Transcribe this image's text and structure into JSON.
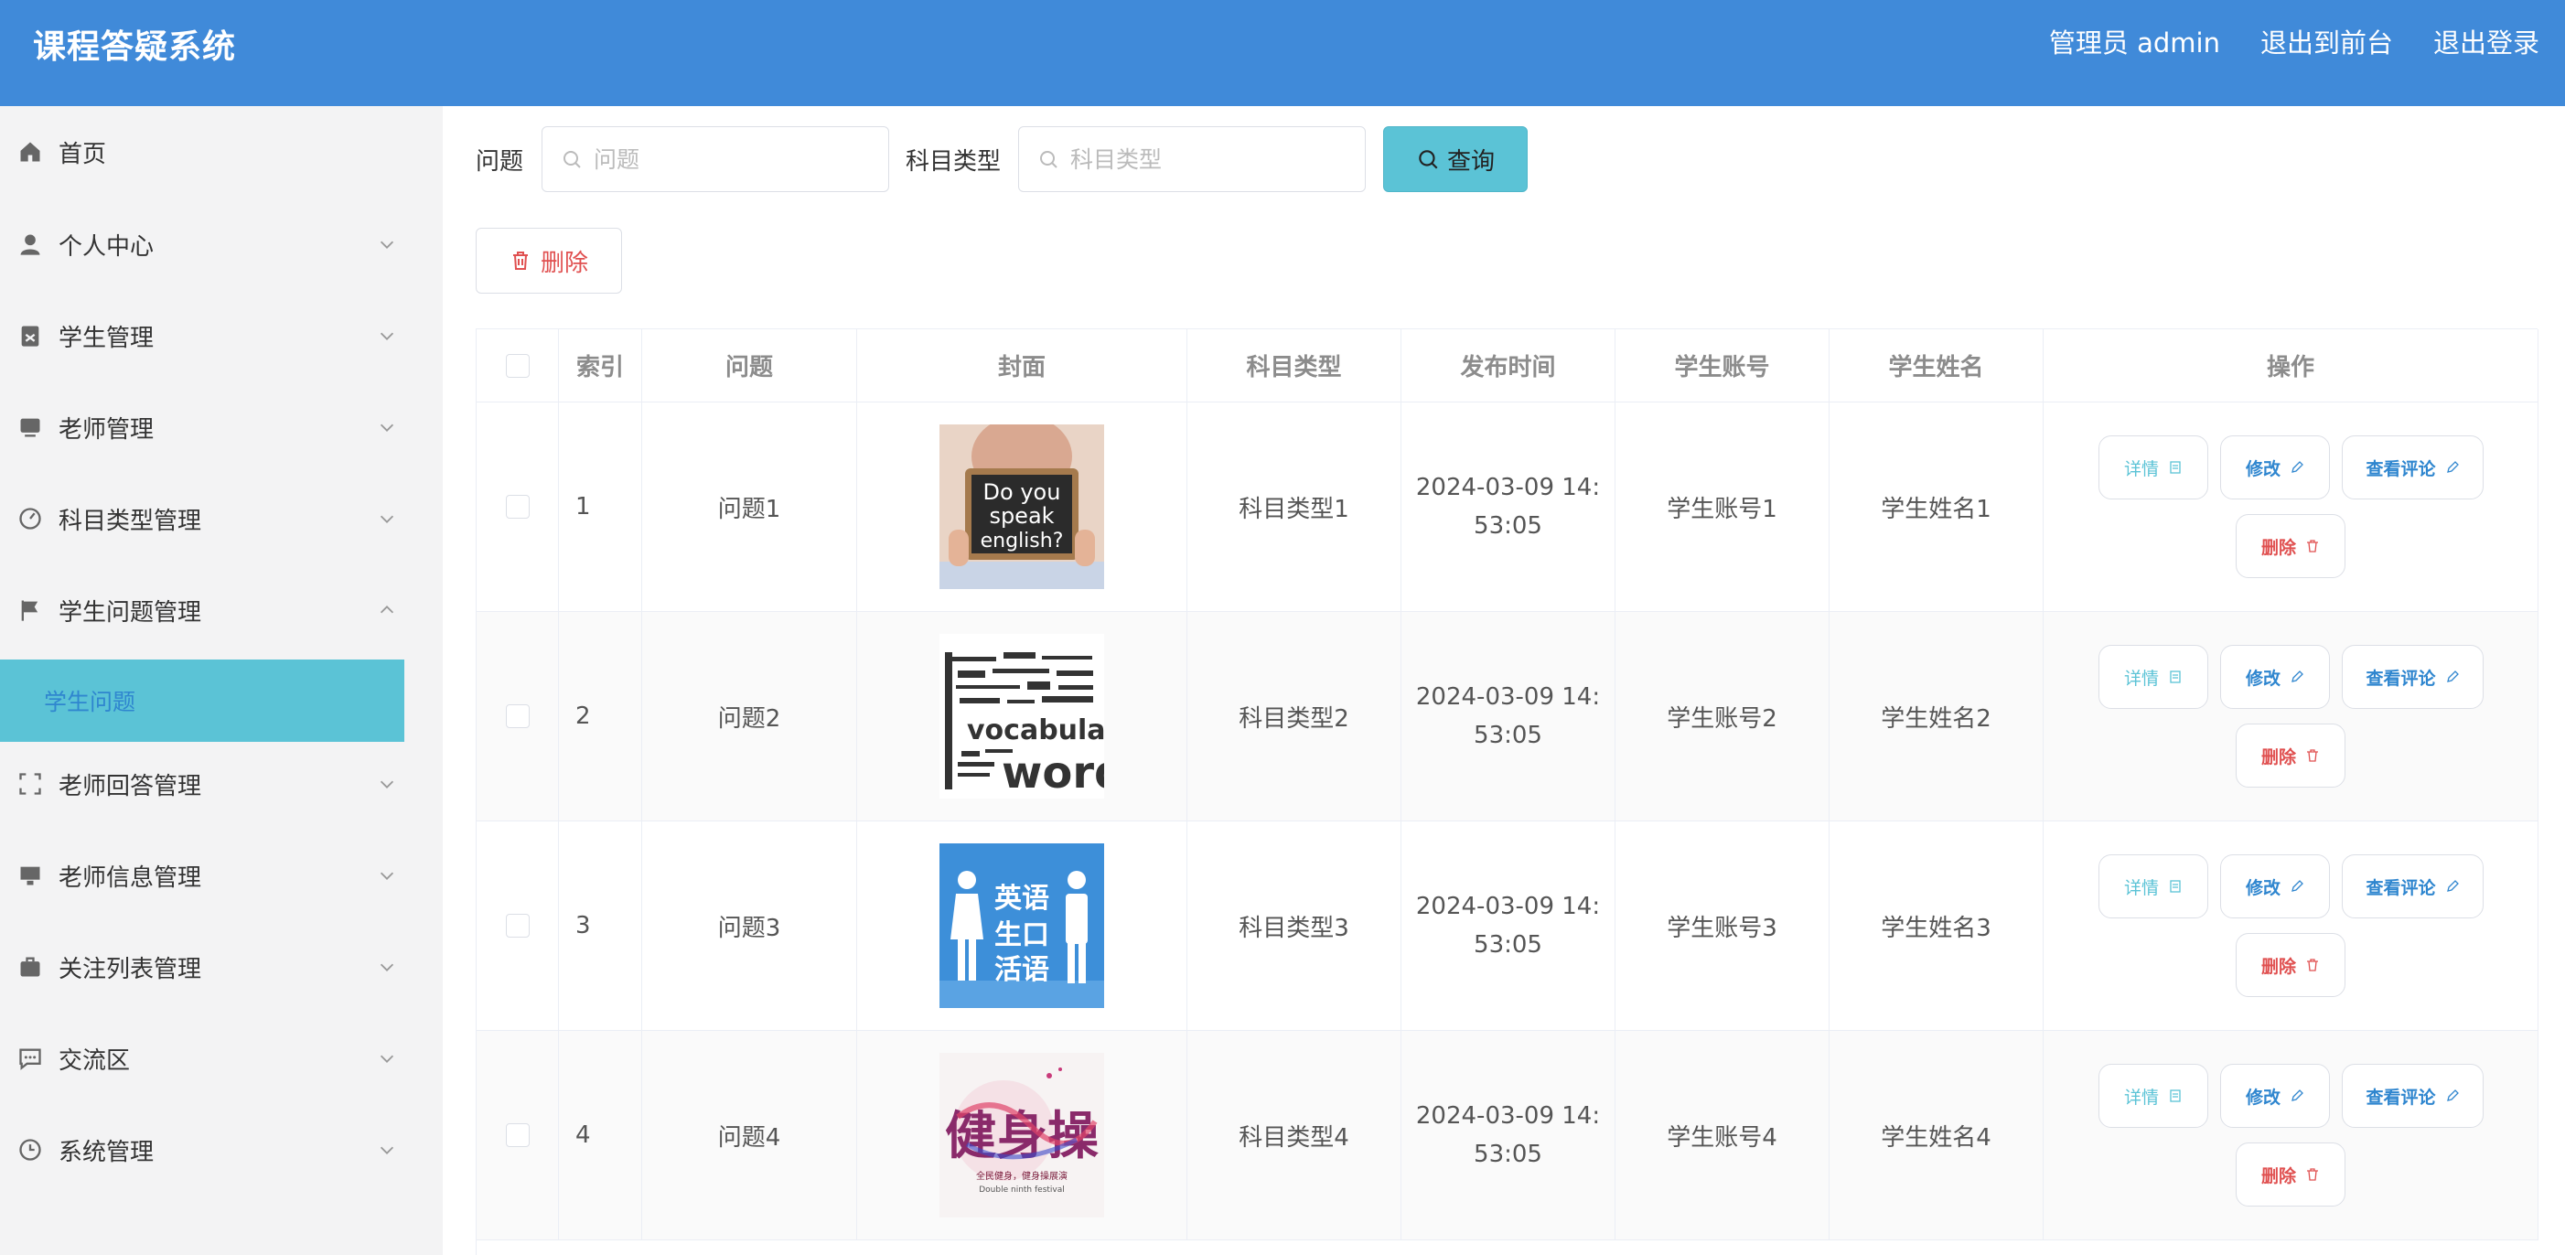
{
  "header": {
    "title": "课程答疑系统",
    "admin_label": "管理员 admin",
    "to_front": "退出到前台",
    "logout": "退出登录"
  },
  "sidebar": {
    "items": [
      {
        "label": "首页",
        "icon": "home-icon"
      },
      {
        "label": "个人中心",
        "icon": "user-icon"
      },
      {
        "label": "学生管理",
        "icon": "clipboard-icon"
      },
      {
        "label": "老师管理",
        "icon": "monitor-icon"
      },
      {
        "label": "科目类型管理",
        "icon": "gauge-icon"
      },
      {
        "label": "学生问题管理",
        "icon": "flag-icon"
      },
      {
        "label": "老师回答管理",
        "icon": "frame-icon"
      },
      {
        "label": "老师信息管理",
        "icon": "desktop-icon"
      },
      {
        "label": "关注列表管理",
        "icon": "briefcase-icon"
      },
      {
        "label": "交流区",
        "icon": "chat-icon"
      },
      {
        "label": "系统管理",
        "icon": "clock-icon"
      }
    ],
    "active_sub": "学生问题"
  },
  "search": {
    "question_label": "问题",
    "question_placeholder": "问题",
    "subject_label": "科目类型",
    "subject_placeholder": "科目类型",
    "query_button": "查询"
  },
  "toolbar": {
    "delete_label": "删除"
  },
  "table": {
    "headers": [
      "索引",
      "问题",
      "封面",
      "科目类型",
      "发布时间",
      "学生账号",
      "学生姓名",
      "操作"
    ],
    "rows": [
      {
        "index": "1",
        "question": "问题1",
        "subject": "科目类型1",
        "time_line1": "2024-03-09 14:",
        "time_line2": "53:05",
        "account": "学生账号1",
        "name": "学生姓名1",
        "cover": "do-you-speak-english"
      },
      {
        "index": "2",
        "question": "问题2",
        "subject": "科目类型2",
        "time_line1": "2024-03-09 14:",
        "time_line2": "53:05",
        "account": "学生账号2",
        "name": "学生姓名2",
        "cover": "vocabulary-words"
      },
      {
        "index": "3",
        "question": "问题3",
        "subject": "科目类型3",
        "time_line1": "2024-03-09 14:",
        "time_line2": "53:05",
        "account": "学生账号3",
        "name": "学生姓名3",
        "cover": "english-spoken"
      },
      {
        "index": "4",
        "question": "问题4",
        "subject": "科目类型4",
        "time_line1": "2024-03-09 14:",
        "time_line2": "53:05",
        "account": "学生账号4",
        "name": "学生姓名4",
        "cover": "fitness-poster"
      }
    ],
    "actions": {
      "detail": "详情",
      "edit": "修改",
      "comment": "查看评论",
      "delete": "删除"
    },
    "cover_texts": {
      "speak": [
        "Do you",
        "speak",
        "english?"
      ],
      "vocab_small": "vocabulary",
      "vocab_big": "words",
      "english_cn": [
        "英语",
        "生口",
        "活语"
      ],
      "fitness_cn": "健身操",
      "fitness_sub": "全民健身，健身操展演",
      "fitness_en": "Double ninth festival"
    }
  },
  "colors": {
    "header_bg": "#408ad9",
    "accent": "#5bc3d6",
    "danger": "#e05050",
    "link": "#2f86cf"
  }
}
